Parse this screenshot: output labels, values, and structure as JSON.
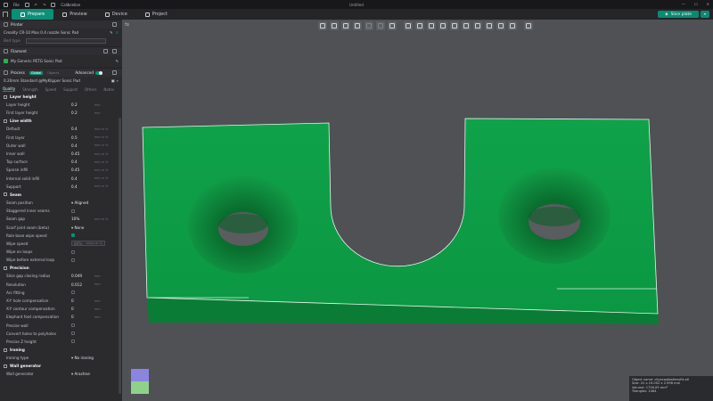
{
  "titlebar": {
    "file_label": "File",
    "calibration_label": "Calibration",
    "window_title": "Untitled"
  },
  "topbar": {
    "tabs": [
      {
        "label": "Prepare",
        "active": true
      },
      {
        "label": "Preview",
        "active": false
      },
      {
        "label": "Device",
        "active": false
      },
      {
        "label": "Project",
        "active": false
      }
    ],
    "slice_button": "Slice plate"
  },
  "printer": {
    "section_title": "Printer",
    "name": "Creality CR-10 Max 0.4 nozzle Sonic Pad",
    "bed_type_label": "Bed type"
  },
  "filament": {
    "section_title": "Filament",
    "item": "My Generic PETG Sonic Pad",
    "index": "1",
    "swatch_color": "#1db954"
  },
  "process": {
    "section_title": "Process",
    "global_badge": "Global",
    "objects_label": "Objects",
    "advanced_label": "Advanced",
    "profile": "0.20mm Standard @MyKlipper Sonic Pad"
  },
  "quality_tabs": [
    "Quality",
    "Strength",
    "Speed",
    "Support",
    "Others",
    "Notes"
  ],
  "groups": {
    "layer_height": "Layer height",
    "line_width": "Line width",
    "seam": "Seam",
    "precision": "Precision",
    "ironing": "Ironing",
    "wall_generator": "Wall generator"
  },
  "rows": {
    "layer_height": {
      "label": "Layer height",
      "value": "0.2",
      "unit": "mm"
    },
    "first_layer_height": {
      "label": "First layer height",
      "value": "0.2",
      "unit": "mm"
    },
    "lw_default": {
      "label": "Default",
      "value": "0.4",
      "unit": "mm or %"
    },
    "lw_first_layer": {
      "label": "First layer",
      "value": "0.5",
      "unit": "mm or %"
    },
    "lw_outer_wall": {
      "label": "Outer wall",
      "value": "0.4",
      "unit": "mm or %"
    },
    "lw_inner_wall": {
      "label": "Inner wall",
      "value": "0.45",
      "unit": "mm or %"
    },
    "lw_top_surface": {
      "label": "Top surface",
      "value": "0.4",
      "unit": "mm or %"
    },
    "lw_sparse_infill": {
      "label": "Sparse infill",
      "value": "0.45",
      "unit": "mm or %"
    },
    "lw_internal_solid": {
      "label": "Internal solid infill",
      "value": "0.4",
      "unit": "mm or %"
    },
    "lw_support": {
      "label": "Support",
      "value": "0.4",
      "unit": "mm or %"
    },
    "seam_position": {
      "label": "Seam position",
      "value": "Aligned"
    },
    "staggered_inner": {
      "label": "Staggered inner seams"
    },
    "seam_gap": {
      "label": "Seam gap",
      "value": "10%",
      "unit": "mm or %"
    },
    "scarf_joint": {
      "label": "Scarf joint seam (beta)",
      "value": "None"
    },
    "role_base_wipe": {
      "label": "Role base wipe speed"
    },
    "wipe_speed": {
      "label": "Wipe speed",
      "value": "80%",
      "unit": "mm/s or %"
    },
    "wipe_on_loops": {
      "label": "Wipe on loops"
    },
    "wipe_before_ext": {
      "label": "Wipe before external loop"
    },
    "slice_gap": {
      "label": "Slice gap closing radius",
      "value": "0.049",
      "unit": "mm"
    },
    "resolution": {
      "label": "Resolution",
      "value": "0.012",
      "unit": "mm"
    },
    "arc_fitting": {
      "label": "Arc fitting"
    },
    "xy_hole": {
      "label": "X-Y hole compensation",
      "value": "0",
      "unit": "mm"
    },
    "xy_contour": {
      "label": "X-Y contour compensation",
      "value": "0",
      "unit": "mm"
    },
    "elephant_foot": {
      "label": "Elephant foot compensation",
      "value": "0",
      "unit": "mm"
    },
    "precise_wall": {
      "label": "Precise wall"
    },
    "convert_holes": {
      "label": "Convert holes to polyholes"
    },
    "precise_z": {
      "label": "Precise Z height"
    },
    "ironing_type": {
      "label": "Ironing type",
      "value": "No ironing"
    },
    "wall_gen": {
      "label": "Wall generator",
      "value": "Arachne"
    }
  },
  "object_info": {
    "name": "Object name: cityscoolbatteryfix.stl",
    "size": "Size: 41 x 19.002 x 2.998 mm",
    "volume": "Volume: 1736.09 mm³",
    "triangles": "Triangles: 1464"
  },
  "colors": {
    "accent": "#0b8f78",
    "model_green": "#0ea84a",
    "viewport_bg": "#4f5155"
  }
}
